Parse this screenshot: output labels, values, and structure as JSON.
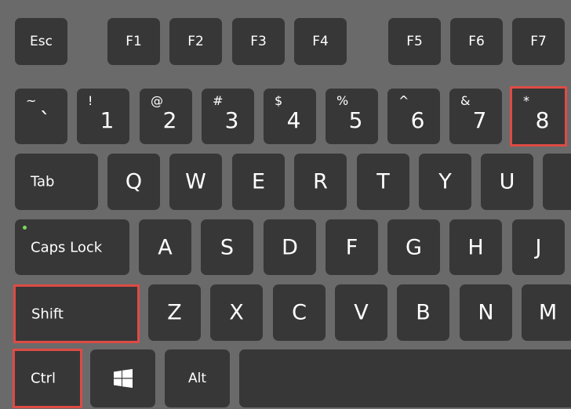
{
  "accent_color": "#de4b45",
  "function_row": [
    "Esc",
    "F1",
    "F2",
    "F3",
    "F4",
    "F5",
    "F6",
    "F7"
  ],
  "number_row": [
    {
      "shift": "~",
      "main": "`"
    },
    {
      "shift": "!",
      "main": "1"
    },
    {
      "shift": "@",
      "main": "2"
    },
    {
      "shift": "#",
      "main": "3"
    },
    {
      "shift": "$",
      "main": "4"
    },
    {
      "shift": "%",
      "main": "5"
    },
    {
      "shift": "^",
      "main": "6"
    },
    {
      "shift": "&",
      "main": "7"
    },
    {
      "shift": "*",
      "main": "8",
      "highlighted": true
    }
  ],
  "top_row": {
    "tab": "Tab",
    "letters": [
      "Q",
      "W",
      "E",
      "R",
      "T",
      "Y",
      "U"
    ]
  },
  "home_row": {
    "caps": "Caps Lock",
    "letters": [
      "A",
      "S",
      "D",
      "F",
      "G",
      "H",
      "J"
    ]
  },
  "bottom_letter_row": {
    "shift": "Shift",
    "shift_highlighted": true,
    "letters": [
      "Z",
      "X",
      "C",
      "V",
      "B",
      "N",
      "M"
    ]
  },
  "modifier_row": {
    "ctrl": "Ctrl",
    "ctrl_highlighted": true,
    "windows_icon": "windows-logo-icon",
    "alt": "Alt"
  }
}
